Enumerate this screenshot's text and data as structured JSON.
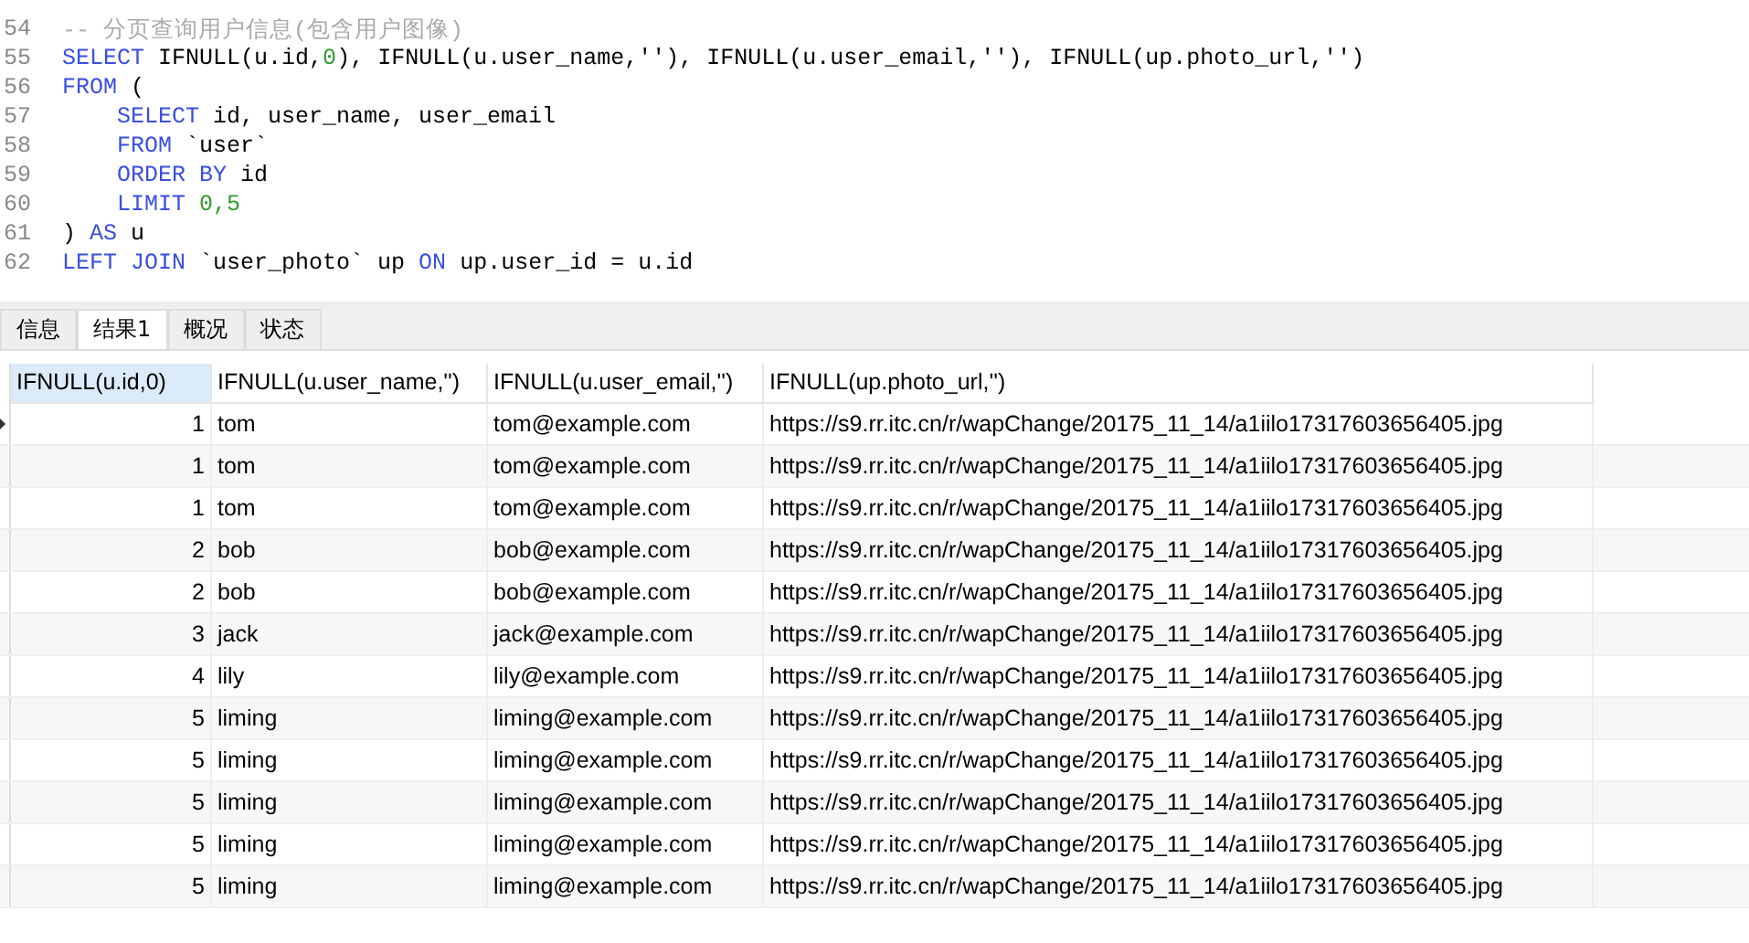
{
  "editor": {
    "lines": [
      {
        "number": "54",
        "indent": false,
        "tokens": [
          {
            "kind": "comment",
            "text": "-- 分页查询用户信息(包含用户图像)"
          }
        ]
      },
      {
        "number": "55",
        "indent": false,
        "tokens": [
          {
            "kind": "keyword",
            "text": "SELECT"
          },
          {
            "kind": "plain",
            "text": " IFNULL(u.id,"
          },
          {
            "kind": "number",
            "text": "0"
          },
          {
            "kind": "plain",
            "text": "), IFNULL(u.user_name,''), IFNULL(u.user_email,''), IFNULL(up.photo_url,'')"
          }
        ]
      },
      {
        "number": "56",
        "indent": false,
        "tokens": [
          {
            "kind": "keyword",
            "text": "FROM"
          },
          {
            "kind": "plain",
            "text": " ("
          }
        ]
      },
      {
        "number": "57",
        "indent": true,
        "tokens": [
          {
            "kind": "keyword",
            "text": "SELECT"
          },
          {
            "kind": "plain",
            "text": " id, user_name, user_email"
          }
        ]
      },
      {
        "number": "58",
        "indent": true,
        "tokens": [
          {
            "kind": "keyword",
            "text": "FROM"
          },
          {
            "kind": "plain",
            "text": " `user`"
          }
        ]
      },
      {
        "number": "59",
        "indent": true,
        "tokens": [
          {
            "kind": "keyword",
            "text": "ORDER BY"
          },
          {
            "kind": "plain",
            "text": " id"
          }
        ]
      },
      {
        "number": "60",
        "indent": true,
        "tokens": [
          {
            "kind": "keyword",
            "text": "LIMIT"
          },
          {
            "kind": "number",
            "text": " 0,5"
          }
        ]
      },
      {
        "number": "61",
        "indent": false,
        "tokens": [
          {
            "kind": "plain",
            "text": ") "
          },
          {
            "kind": "keyword",
            "text": "AS"
          },
          {
            "kind": "plain",
            "text": " u"
          }
        ]
      },
      {
        "number": "62",
        "indent": false,
        "tokens": [
          {
            "kind": "keyword",
            "text": "LEFT JOIN"
          },
          {
            "kind": "plain",
            "text": " `user_photo` up "
          },
          {
            "kind": "keyword",
            "text": "ON"
          },
          {
            "kind": "plain",
            "text": " up.user_id = u.id"
          }
        ]
      }
    ]
  },
  "tabs": [
    {
      "label": "信息",
      "selected": false
    },
    {
      "label": "结果1",
      "selected": true
    },
    {
      "label": "概况",
      "selected": false
    },
    {
      "label": "状态",
      "selected": false
    }
  ],
  "table": {
    "columns": [
      "IFNULL(u.id,0)",
      "IFNULL(u.user_name,'')",
      "IFNULL(u.user_email,'')",
      "IFNULL(up.photo_url,'')"
    ],
    "rows": [
      {
        "selected": true,
        "cells": [
          "1",
          "tom",
          "tom@example.com",
          "https://s9.rr.itc.cn/r/wapChange/20175_11_14/a1iilo17317603656405.jpg"
        ]
      },
      {
        "selected": false,
        "cells": [
          "1",
          "tom",
          "tom@example.com",
          "https://s9.rr.itc.cn/r/wapChange/20175_11_14/a1iilo17317603656405.jpg"
        ]
      },
      {
        "selected": false,
        "cells": [
          "1",
          "tom",
          "tom@example.com",
          "https://s9.rr.itc.cn/r/wapChange/20175_11_14/a1iilo17317603656405.jpg"
        ]
      },
      {
        "selected": false,
        "cells": [
          "2",
          "bob",
          "bob@example.com",
          "https://s9.rr.itc.cn/r/wapChange/20175_11_14/a1iilo17317603656405.jpg"
        ]
      },
      {
        "selected": false,
        "cells": [
          "2",
          "bob",
          "bob@example.com",
          "https://s9.rr.itc.cn/r/wapChange/20175_11_14/a1iilo17317603656405.jpg"
        ]
      },
      {
        "selected": false,
        "cells": [
          "3",
          "jack",
          "jack@example.com",
          "https://s9.rr.itc.cn/r/wapChange/20175_11_14/a1iilo17317603656405.jpg"
        ]
      },
      {
        "selected": false,
        "cells": [
          "4",
          "lily",
          "lily@example.com",
          "https://s9.rr.itc.cn/r/wapChange/20175_11_14/a1iilo17317603656405.jpg"
        ]
      },
      {
        "selected": false,
        "cells": [
          "5",
          "liming",
          "liming@example.com",
          "https://s9.rr.itc.cn/r/wapChange/20175_11_14/a1iilo17317603656405.jpg"
        ]
      },
      {
        "selected": false,
        "cells": [
          "5",
          "liming",
          "liming@example.com",
          "https://s9.rr.itc.cn/r/wapChange/20175_11_14/a1iilo17317603656405.jpg"
        ]
      },
      {
        "selected": false,
        "cells": [
          "5",
          "liming",
          "liming@example.com",
          "https://s9.rr.itc.cn/r/wapChange/20175_11_14/a1iilo17317603656405.jpg"
        ]
      },
      {
        "selected": false,
        "cells": [
          "5",
          "liming",
          "liming@example.com",
          "https://s9.rr.itc.cn/r/wapChange/20175_11_14/a1iilo17317603656405.jpg"
        ]
      },
      {
        "selected": false,
        "cells": [
          "5",
          "liming",
          "liming@example.com",
          "https://s9.rr.itc.cn/r/wapChange/20175_11_14/a1iilo17317603656405.jpg"
        ]
      }
    ]
  }
}
